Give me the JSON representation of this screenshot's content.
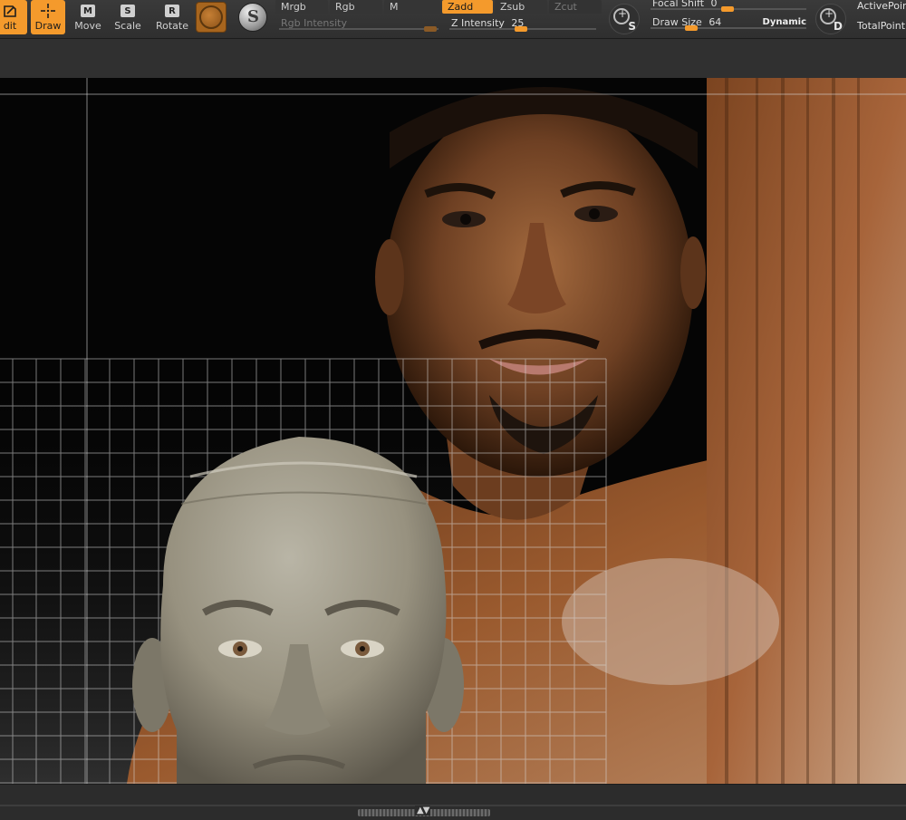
{
  "toolbar": {
    "tools": [
      {
        "label": "dit",
        "active": true,
        "icon": "edit-icon"
      },
      {
        "label": "Draw",
        "active": true,
        "icon": "draw-crosshair-icon"
      },
      {
        "label": "Move",
        "key": "M"
      },
      {
        "label": "Scale",
        "key": "S"
      },
      {
        "label": "Rotate",
        "key": "R"
      }
    ],
    "material_icon": "material-sphere-icon",
    "stroke_icon": "stroke-icon",
    "modes": {
      "mrgb": "Mrgb",
      "rgb": "Rgb",
      "m": "M",
      "zadd": "Zadd",
      "zsub": "Zsub",
      "zcut": "Zcut"
    },
    "rgb_intensity": {
      "label": "Rgb Intensity",
      "enabled": false
    },
    "z_intensity": {
      "label": "Z Intensity",
      "value": "25"
    },
    "focal_shift": {
      "label": "Focal Shift",
      "value": "0"
    },
    "draw_size": {
      "label": "Draw Size",
      "value": "64",
      "dynamic": "Dynamic"
    },
    "symmetry_badge_s": "S",
    "symmetry_badge_d": "D",
    "active_points": "ActivePoin",
    "total_points": "TotalPoint"
  },
  "colors": {
    "accent": "#f49a2c",
    "panel": "#2f2f2f",
    "grid": "#d9d9d9"
  },
  "viewport": {
    "reference_image": "reference-portrait-image",
    "sculpt": "sculpted-head-model",
    "grid": "perspective-floor-grid"
  }
}
